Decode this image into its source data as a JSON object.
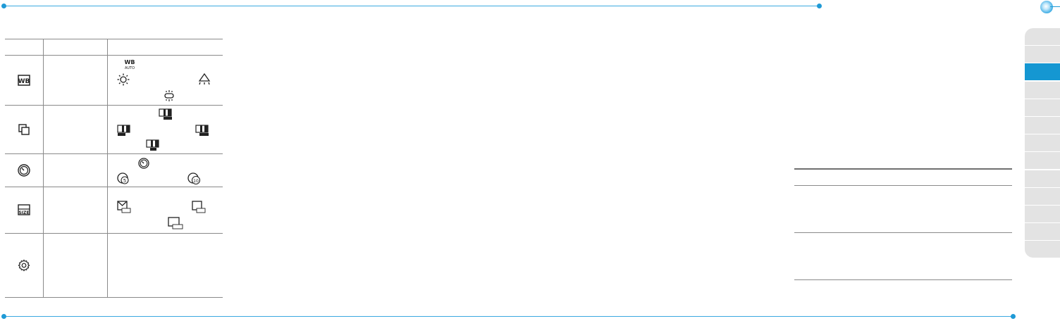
{
  "page": {
    "accent": "#1597d2",
    "guide_color": "#3aa9e0",
    "rule_color": "#8a8a8a",
    "tab_color": "#e3e3e3"
  },
  "menu_table": {
    "header": {
      "col1": "",
      "col2": "",
      "col3": ""
    },
    "rows": [
      {
        "name": "white-balance",
        "icon": "white-balance-icon",
        "label": "",
        "desc": "",
        "options": [
          "wb-auto-icon",
          "daylight-icon",
          "incandescent-icon",
          "fluorescent-icon"
        ]
      },
      {
        "name": "color-effects",
        "icon": "effects-icon",
        "label": "",
        "desc": "",
        "options": [
          "effect-tone-icon",
          "effect-sepia-icon",
          "effect-negative-icon",
          "effect-bw-icon"
        ]
      },
      {
        "name": "self-timer",
        "icon": "timer-icon",
        "label": "",
        "desc": "",
        "options": [
          "timer-off-icon",
          "timer-5-icon",
          "timer-10-icon"
        ]
      },
      {
        "name": "picture-size",
        "icon": "size-icon",
        "label": "",
        "desc": "",
        "options": [
          "size-176-mail-icon",
          "size-176-icon",
          "size-320-icon"
        ]
      },
      {
        "name": "settings",
        "icon": "settings-gear-icon",
        "label": "",
        "desc": "",
        "options": []
      }
    ]
  },
  "right_table": {
    "rows": [
      "",
      "",
      ""
    ]
  },
  "chapter_tabs": {
    "count": 13,
    "active_index": 2
  }
}
